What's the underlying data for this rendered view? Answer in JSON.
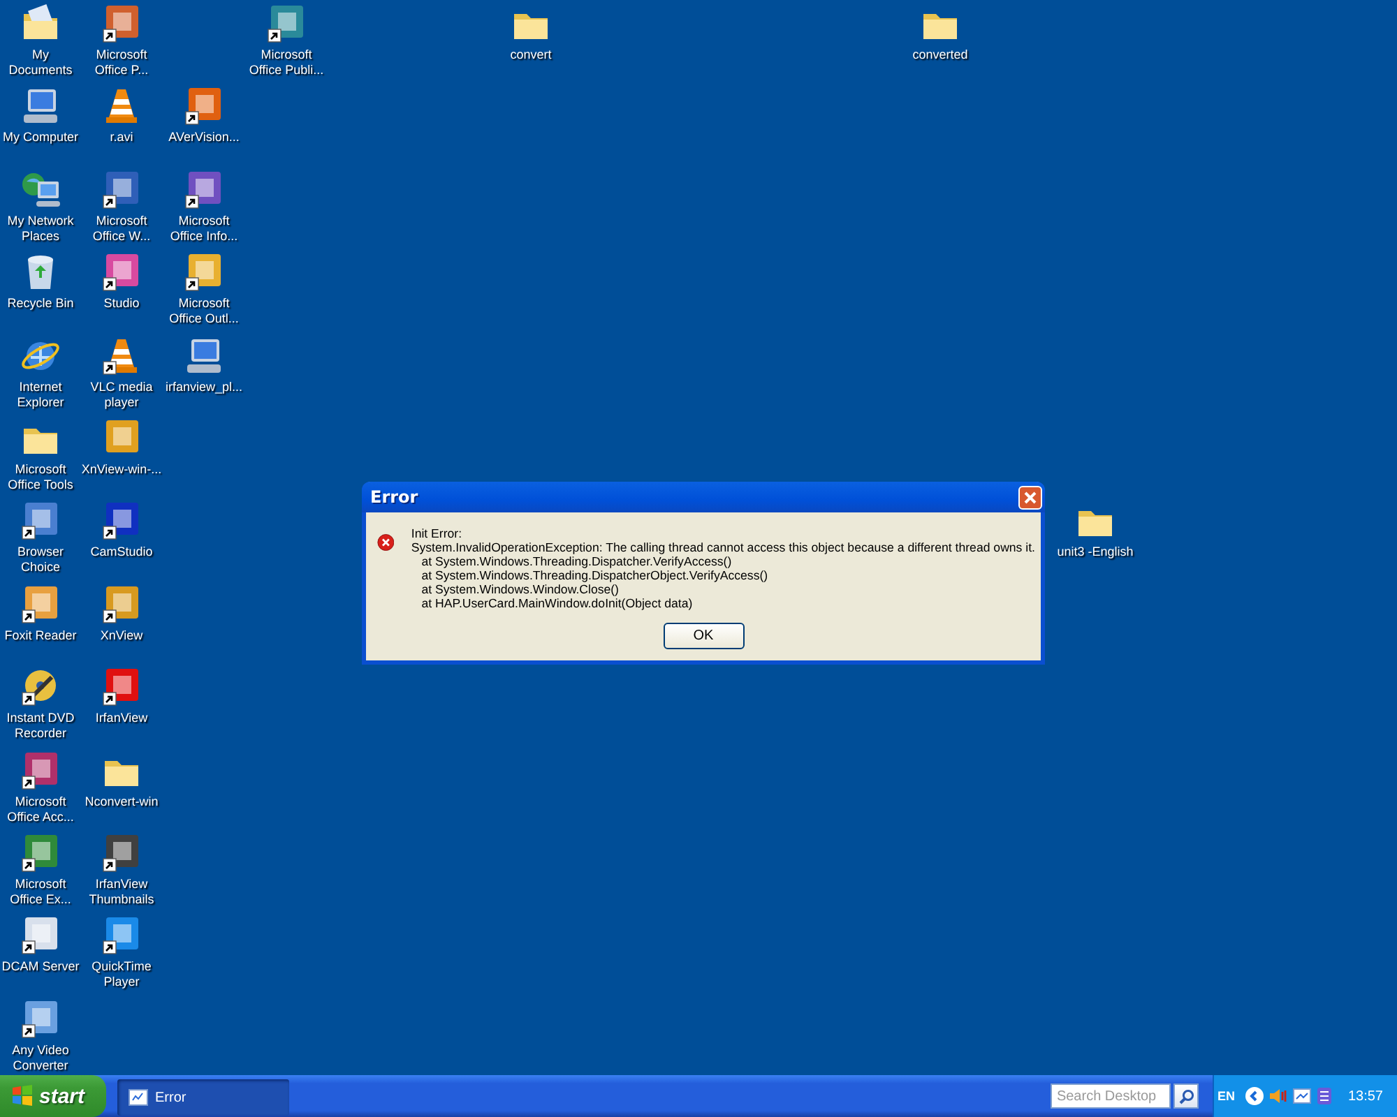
{
  "desktop": {
    "icons": [
      {
        "label": "My Documents",
        "kind": "documents",
        "shortcut": false
      },
      {
        "label": "My Computer",
        "kind": "computer",
        "shortcut": false
      },
      {
        "label": "My Network Places",
        "kind": "network",
        "shortcut": false
      },
      {
        "label": "Recycle Bin",
        "kind": "recycle-bin",
        "shortcut": false
      },
      {
        "label": "Internet Explorer",
        "kind": "globe",
        "shortcut": false
      },
      {
        "label": "Microsoft Office Tools",
        "kind": "folder",
        "shortcut": false
      },
      {
        "label": "Browser Choice",
        "kind": "tile",
        "color": "#4a7fd0",
        "shortcut": true
      },
      {
        "label": "Foxit Reader",
        "kind": "tile",
        "color": "#e8a040",
        "shortcut": true
      },
      {
        "label": "Instant DVD Recorder",
        "kind": "disc",
        "shortcut": true
      },
      {
        "label": "Microsoft Office Acc...",
        "kind": "tile",
        "color": "#b0306a",
        "shortcut": true
      },
      {
        "label": "Microsoft Office Ex...",
        "kind": "tile",
        "color": "#2f8a3a",
        "shortcut": true
      },
      {
        "label": "DCAM Server",
        "kind": "tile",
        "color": "#d8e0ec",
        "shortcut": true
      },
      {
        "label": "Any Video Converter",
        "kind": "tile",
        "color": "#6aa0e0",
        "shortcut": true
      },
      {
        "label": "Microsoft Office P...",
        "kind": "tile",
        "color": "#d0602e",
        "shortcut": true
      },
      {
        "label": "r.avi",
        "kind": "cone",
        "shortcut": false
      },
      {
        "label": "Microsoft Office W...",
        "kind": "tile",
        "color": "#2f5fb8",
        "shortcut": true
      },
      {
        "label": "Studio",
        "kind": "tile",
        "color": "#d84aa0",
        "shortcut": true
      },
      {
        "label": "VLC media player",
        "kind": "cone",
        "shortcut": true
      },
      {
        "label": "XnView-win-...",
        "kind": "tile",
        "color": "#e0a020",
        "shortcut": false
      },
      {
        "label": "CamStudio",
        "kind": "tile",
        "color": "#1030c0",
        "shortcut": true
      },
      {
        "label": "XnView",
        "kind": "tile",
        "color": "#d89a20",
        "shortcut": true
      },
      {
        "label": "IrfanView",
        "kind": "tile",
        "color": "#e01010",
        "shortcut": true
      },
      {
        "label": "Nconvert-win",
        "kind": "folder",
        "shortcut": false
      },
      {
        "label": "IrfanView Thumbnails",
        "kind": "tile",
        "color": "#404040",
        "shortcut": true
      },
      {
        "label": "QuickTime Player",
        "kind": "tile",
        "color": "#1a8ae8",
        "shortcut": true
      },
      {
        "label": "AVerVision...",
        "kind": "tile",
        "color": "#e06010",
        "shortcut": true
      },
      {
        "label": "Microsoft Office Info...",
        "kind": "tile",
        "color": "#7050c0",
        "shortcut": true
      },
      {
        "label": "Microsoft Office Outl...",
        "kind": "tile",
        "color": "#e8b030",
        "shortcut": true
      },
      {
        "label": "irfanview_pl...",
        "kind": "computer",
        "shortcut": false
      },
      {
        "label": "Microsoft Office Publi...",
        "kind": "tile",
        "color": "#2a8a9a",
        "shortcut": true
      },
      {
        "label": "convert",
        "kind": "folder",
        "shortcut": false
      },
      {
        "label": "converted",
        "kind": "folder",
        "shortcut": false
      },
      {
        "label": "unit3 -English",
        "kind": "folder",
        "shortcut": false
      }
    ]
  },
  "dialog": {
    "title": "Error",
    "heading": "Init Error:",
    "message_lines": [
      "System.InvalidOperationException: The calling thread cannot access this object because a different thread owns it.",
      "   at System.Windows.Threading.Dispatcher.VerifyAccess()",
      "   at System.Windows.Threading.DispatcherObject.VerifyAccess()",
      "   at System.Windows.Window.Close()",
      "   at HAP.UserCard.MainWindow.doInit(Object data)"
    ],
    "buttons": [
      "OK"
    ]
  },
  "taskbar": {
    "start": "start",
    "tasks": [
      {
        "label": "Error",
        "selected": true
      }
    ],
    "search": {
      "placeholder": "Search Desktop"
    },
    "language": "EN",
    "clock": "13:57"
  }
}
